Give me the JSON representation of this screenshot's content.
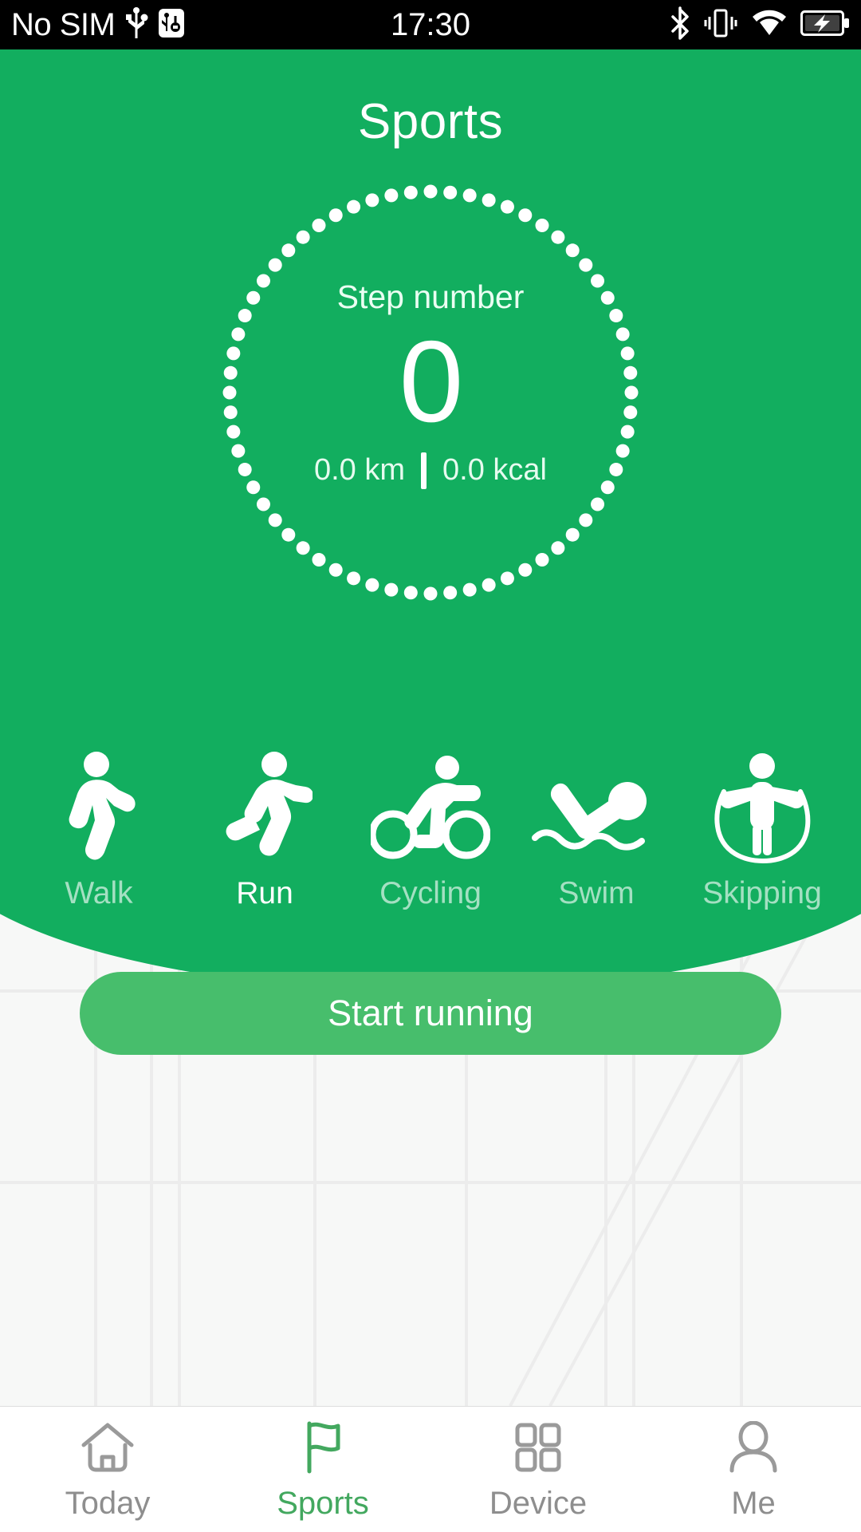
{
  "status_bar": {
    "carrier": "No SIM",
    "clock": "17:30",
    "icons_left": [
      "usb-icon",
      "usb-debug-icon"
    ],
    "icons_right": [
      "bluetooth-icon",
      "vibrate-icon",
      "wifi-icon",
      "battery-charging-icon"
    ]
  },
  "header": {
    "title": "Sports",
    "accent_color": "#12AE5F"
  },
  "ring": {
    "step_label": "Step number",
    "step_value": "0",
    "distance": "0.0 km",
    "calories": "0.0 kcal"
  },
  "activities": [
    {
      "label": "Walk",
      "icon": "walking-icon",
      "selected": false
    },
    {
      "label": "Run",
      "icon": "running-icon",
      "selected": true
    },
    {
      "label": "Cycling",
      "icon": "cycling-icon",
      "selected": false
    },
    {
      "label": "Swim",
      "icon": "swimming-icon",
      "selected": false
    },
    {
      "label": "Skipping",
      "icon": "skipping-icon",
      "selected": false
    }
  ],
  "action": {
    "start_label": "Start running",
    "button_color": "#47BE6C"
  },
  "bottom_nav": {
    "active_color": "#43A85F",
    "inactive_color": "#8e8e8e",
    "items": [
      {
        "label": "Today",
        "icon": "home-icon",
        "active": false
      },
      {
        "label": "Sports",
        "icon": "flag-icon",
        "active": true
      },
      {
        "label": "Device",
        "icon": "grid-icon",
        "active": false
      },
      {
        "label": "Me",
        "icon": "person-icon",
        "active": false
      }
    ]
  }
}
